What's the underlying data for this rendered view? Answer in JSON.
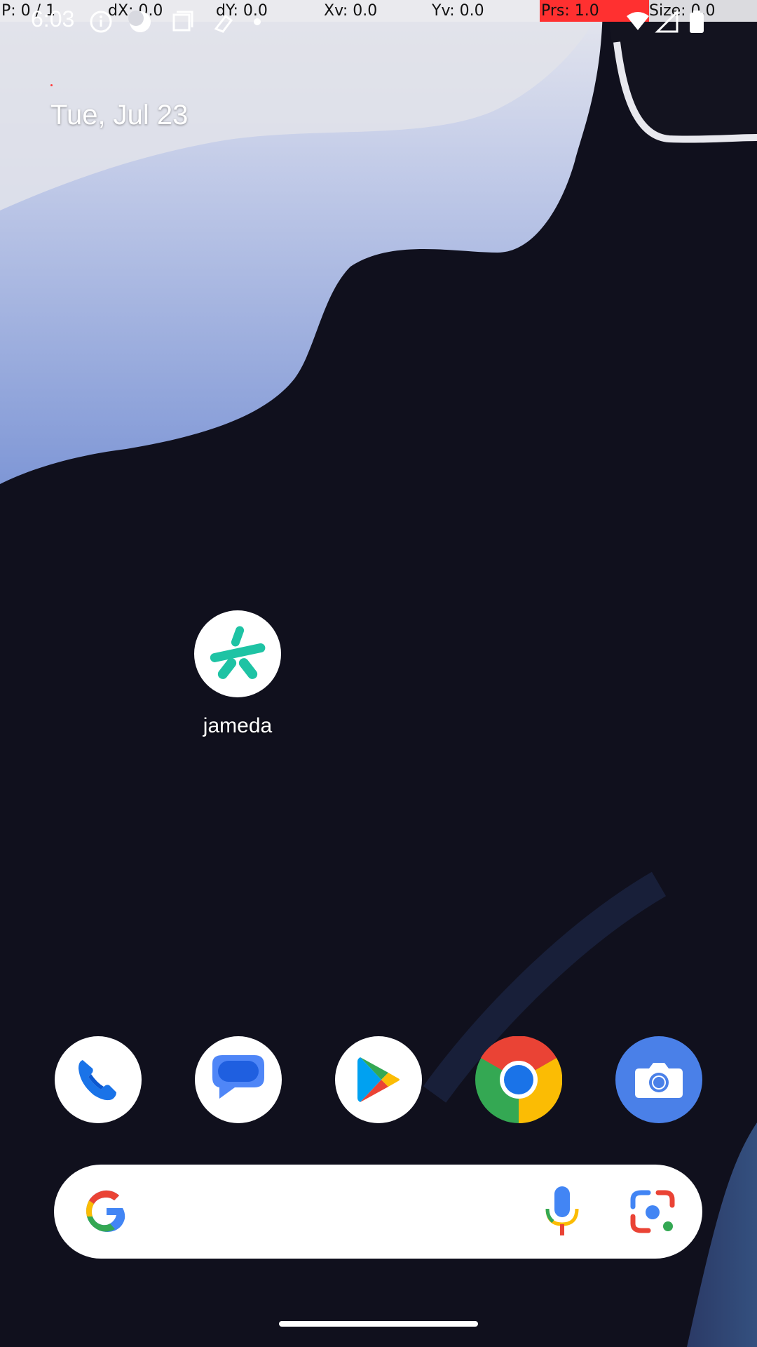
{
  "debug_bar": {
    "pointer": "P: 0 / 1",
    "dx": "dX: 0.0",
    "dy": "dY: 0.0",
    "xv": "Xv: 0.0",
    "yv": "Yv: 0.0",
    "prs": "Prs: 1.0",
    "size": "Size: 0.0"
  },
  "status_bar": {
    "time": "6:03",
    "left_icons": [
      "info-icon",
      "night-mode-icon",
      "screenshot-icon",
      "vpn-key-icon",
      "notification-dot-icon"
    ],
    "right_icons": [
      "wifi-icon",
      "signal-icon",
      "battery-icon"
    ]
  },
  "home": {
    "date": "Tue, Jul 23",
    "apps": [
      {
        "label": "jameda",
        "icon": "jameda-icon",
        "brand_color": "#1ec3a4"
      }
    ]
  },
  "dock": {
    "apps": [
      {
        "name": "Phone",
        "icon": "phone-icon"
      },
      {
        "name": "Messages",
        "icon": "messages-icon"
      },
      {
        "name": "Play Store",
        "icon": "play-store-icon"
      },
      {
        "name": "Chrome",
        "icon": "chrome-icon"
      },
      {
        "name": "Camera",
        "icon": "camera-icon"
      }
    ]
  },
  "search_bar": {
    "icons": [
      "google-g-icon",
      "microphone-icon",
      "google-lens-icon"
    ]
  },
  "colors": {
    "google_blue": "#4285f4",
    "google_red": "#ea4335",
    "google_yellow": "#fbbc04",
    "google_green": "#34a853",
    "debug_highlight": "#ff3030"
  }
}
